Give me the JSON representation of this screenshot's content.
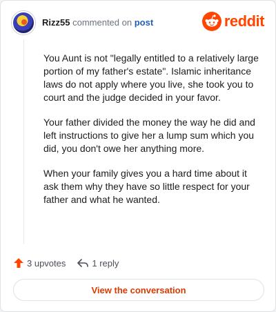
{
  "header": {
    "username": "Rizz55",
    "verb": "commented on",
    "target": "post",
    "brand": "reddit"
  },
  "comment": {
    "paragraphs": [
      "You Aunt is not \"legally entitled to a relatively large portion of my father's estate\". Islamic inheritance laws do not apply where you live, she took you to court and the judge decided in your favor.",
      "Your father divided the money the way he did and left instructions to give her a lump sum which you did, you don't owe her anything more.",
      "When your family gives you a hard time about it ask them why they have so little respect for your father and what he wanted."
    ]
  },
  "actions": {
    "upvotes_label": "3 upvotes",
    "reply_label": "1 reply"
  },
  "cta": {
    "label": "View the conversation"
  },
  "colors": {
    "brand": "#ff4500",
    "link": "#1f5fb5",
    "cta_text": "#d93a00"
  },
  "icons": {
    "upvote": "upvote-arrow-icon",
    "reply": "reply-arrow-icon",
    "brand": "reddit-logo-icon"
  }
}
